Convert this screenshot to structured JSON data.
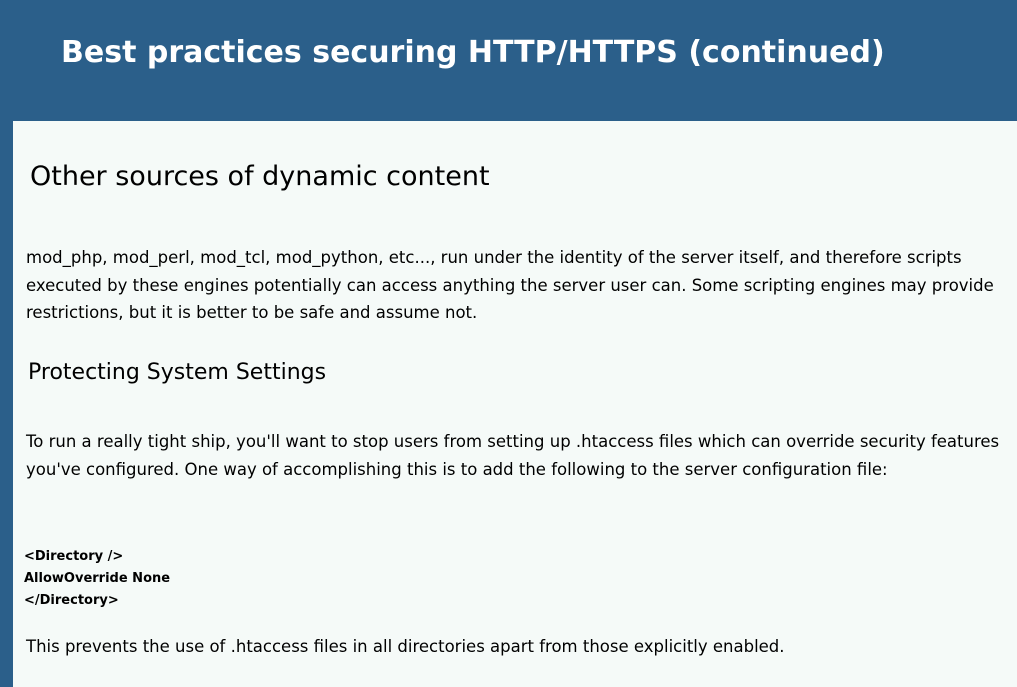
{
  "slide": {
    "title": "Best practices securing HTTP/HTTPS (continued)"
  },
  "content": {
    "section_heading": "Other sources of dynamic content",
    "paragraph_dynamic": "mod_php, mod_perl, mod_tcl, mod_python, etc..., run under the identity of the server itself, and therefore scripts executed by these engines potentially can access anything the server user can.  Some scripting engines may provide restrictions, but it is better to be safe and assume not.",
    "subsection_heading": "Protecting System Settings",
    "paragraph_protecting": "To run a really tight ship, you'll want to stop users from setting up .htaccess files which can override security features you've configured. One way of accomplishing this is to add the following to the server configuration file:",
    "code_lines": [
      "<Directory />",
      "AllowOverride None",
      "</Directory>"
    ],
    "paragraph_conclusion": "This prevents the use of .htaccess files in all directories apart from those explicitly enabled."
  },
  "colors": {
    "header_background": "#2b5f8a",
    "panel_background": "#f5faf8",
    "title_text": "#ffffff",
    "body_text": "#000000"
  }
}
